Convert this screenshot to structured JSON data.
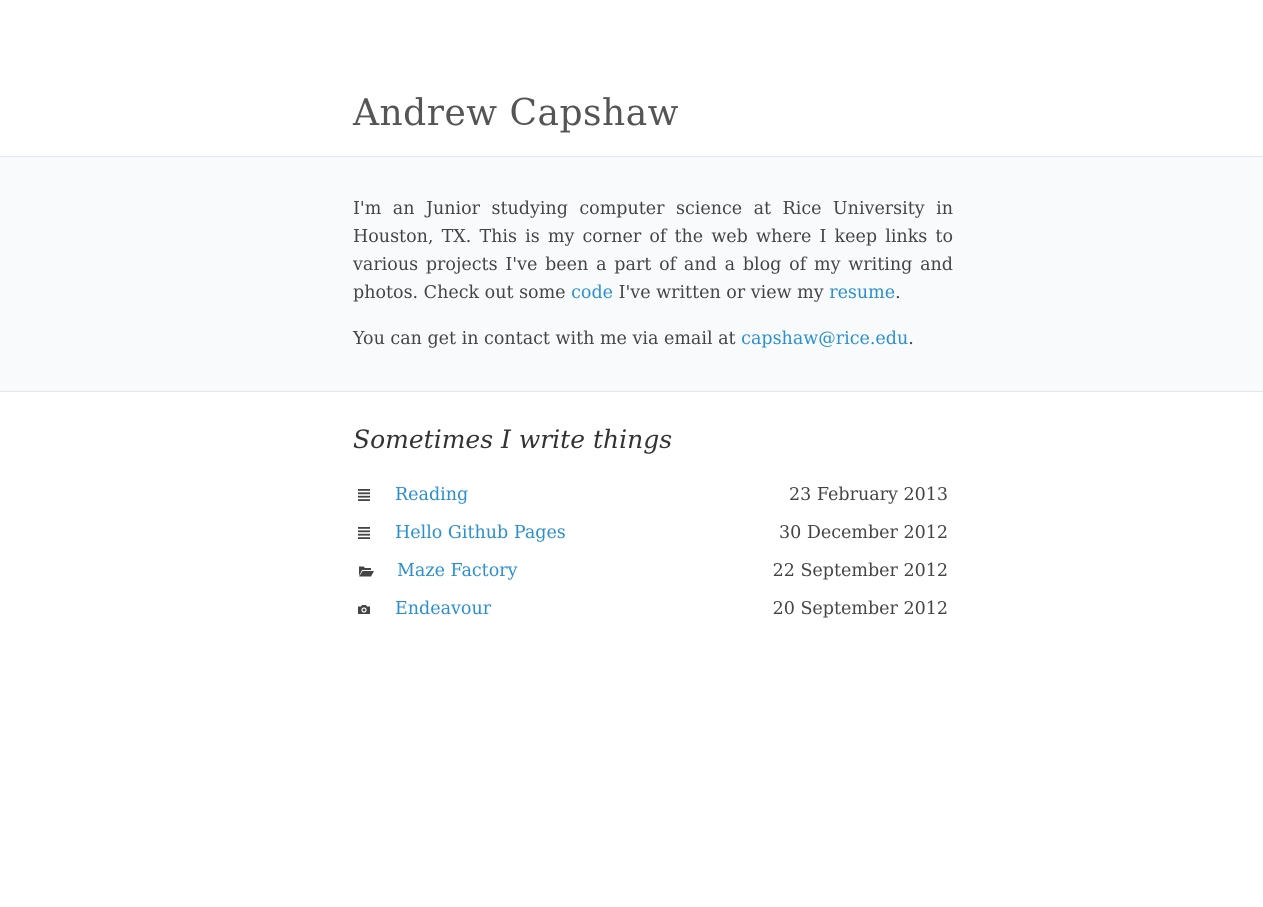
{
  "header": {
    "title": "Andrew Capshaw"
  },
  "intro": {
    "para1_text_a": "I'm an Junior studying computer science at Rice University in Hous­ton, TX. This is my corner of the web where I keep links to various projects I've been a part of and a blog of my writing and photos. Check out some ",
    "code_link": "code",
    "para1_text_b": " I've written or view my ",
    "resume_link": "resume",
    "para1_text_c": ".",
    "contact_text": "You can get in contact with me via email at ",
    "email_link": "capshaw@rice.edu",
    "contact_end": "."
  },
  "posts": {
    "heading": "Sometimes I write things",
    "items": [
      {
        "icon": "text-lines-icon",
        "title": "Reading",
        "date": "23 February 2013"
      },
      {
        "icon": "text-lines-icon",
        "title": "Hello Github Pages",
        "date": "30 December 2012"
      },
      {
        "icon": "folder-open-icon",
        "title": "Maze Factory",
        "date": "22 September 2012"
      },
      {
        "icon": "camera-icon",
        "title": "Endeavour",
        "date": "20 September 2012"
      }
    ]
  },
  "colors": {
    "link": "#2a8fd0",
    "text": "#444444",
    "intro_bg": "#f9fafc",
    "border": "#e3e6ea"
  }
}
